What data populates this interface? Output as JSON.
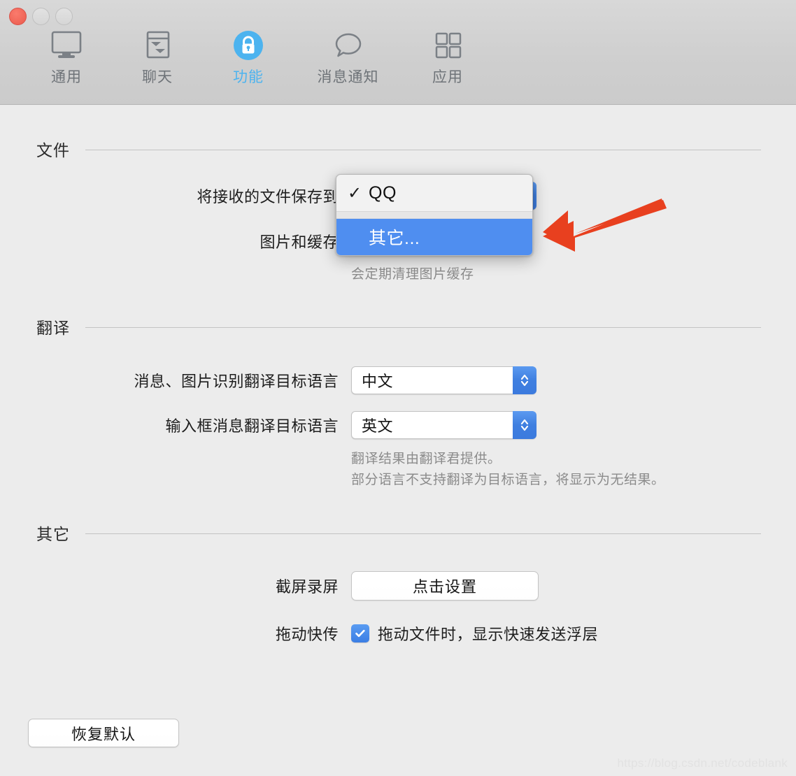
{
  "window": {
    "traffic_lights": [
      "close",
      "minimize",
      "zoom"
    ]
  },
  "toolbar": {
    "tabs": [
      {
        "label": "通用",
        "icon": "monitor-icon",
        "active": false
      },
      {
        "label": "聊天",
        "icon": "chat-window-icon",
        "active": false
      },
      {
        "label": "功能",
        "icon": "lock-icon",
        "active": true
      },
      {
        "label": "消息通知",
        "icon": "speech-bubble-icon",
        "active": false
      },
      {
        "label": "应用",
        "icon": "grid-icon",
        "active": false
      }
    ],
    "active_color": "#4cb3ef"
  },
  "sections": {
    "file": {
      "title": "文件",
      "rows": {
        "save_to_label": "将接收的文件保存到",
        "save_to_value": "QQ",
        "cache_label": "图片和缓存",
        "cache_hint": "会定期清理图片缓存"
      }
    },
    "translate": {
      "title": "翻译",
      "rows": {
        "message_label": "消息、图片识别翻译目标语言",
        "message_value": "中文",
        "input_label": "输入框消息翻译目标语言",
        "input_value": "英文"
      },
      "hint": "翻译结果由翻译君提供。\n部分语言不支持翻译为目标语言，将显示为无结果。"
    },
    "other": {
      "title": "其它",
      "rows": {
        "screenshot_label": "截屏录屏",
        "screenshot_button": "点击设置",
        "dragsend_label": "拖动快传",
        "dragsend_checkbox_label": "拖动文件时，显示快速发送浮层",
        "dragsend_checked": true
      }
    }
  },
  "dropdown": {
    "items": [
      {
        "label": "QQ",
        "checked": true,
        "selected": false
      },
      {
        "label": "其它...",
        "checked": false,
        "selected": true
      }
    ],
    "highlight_color": "#4f8ef0"
  },
  "footer": {
    "restore_defaults": "恢复默认"
  },
  "annotation": {
    "arrow_color": "#e8401f"
  },
  "watermark": {
    "text": "https://blog.csdn.net/codeblank"
  }
}
